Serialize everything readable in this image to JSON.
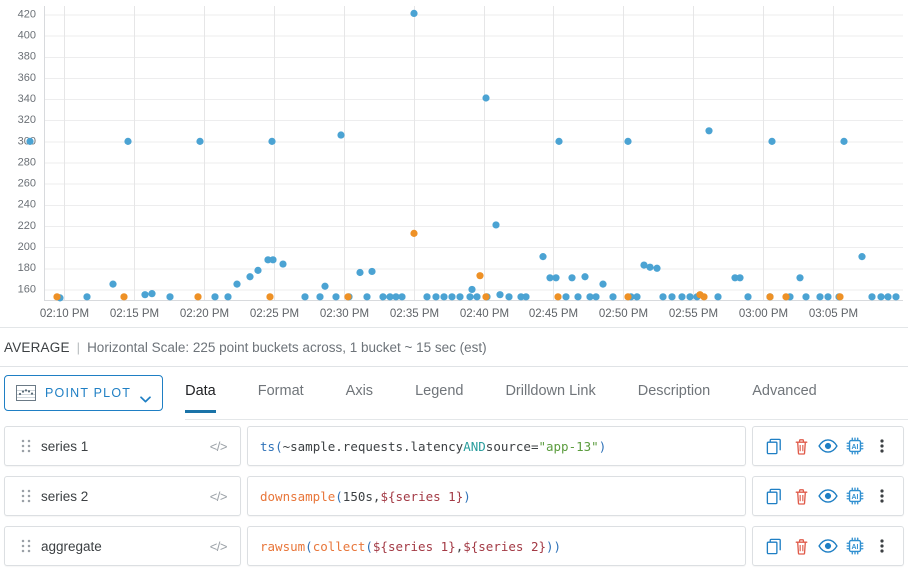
{
  "chart_data": {
    "type": "scatter",
    "title": "",
    "xlabel": "",
    "ylabel": "",
    "ylim": [
      150,
      428
    ],
    "yticks": [
      160,
      180,
      200,
      220,
      240,
      260,
      280,
      300,
      320,
      340,
      360,
      380,
      400,
      420
    ],
    "xticks": [
      "02:10 PM",
      "02:15 PM",
      "02:20 PM",
      "02:25 PM",
      "02:30 PM",
      "02:35 PM",
      "02:40 PM",
      "02:45 PM",
      "02:50 PM",
      "02:55 PM",
      "03:00 PM",
      "03:05 PM"
    ],
    "grid": true,
    "legend": "none",
    "series": [
      {
        "name": "series 1",
        "color": "#4ba3d3",
        "points": [
          [
            30,
            300
          ],
          [
            60,
            152
          ],
          [
            87,
            153
          ],
          [
            113,
            165
          ],
          [
            128,
            300
          ],
          [
            145,
            155
          ],
          [
            152,
            156
          ],
          [
            170,
            153
          ],
          [
            200,
            300
          ],
          [
            215,
            153
          ],
          [
            228,
            153
          ],
          [
            237,
            165
          ],
          [
            250,
            172
          ],
          [
            258,
            178
          ],
          [
            268,
            188
          ],
          [
            273,
            188
          ],
          [
            283,
            184
          ],
          [
            272,
            300
          ],
          [
            305,
            153
          ],
          [
            320,
            153
          ],
          [
            325,
            163
          ],
          [
            336,
            153
          ],
          [
            341,
            306
          ],
          [
            349,
            153
          ],
          [
            360,
            176
          ],
          [
            367,
            153
          ],
          [
            372,
            177
          ],
          [
            383,
            153
          ],
          [
            390,
            153
          ],
          [
            396,
            153
          ],
          [
            402,
            153
          ],
          [
            414,
            421
          ],
          [
            427,
            153
          ],
          [
            436,
            153
          ],
          [
            444,
            153
          ],
          [
            452,
            153
          ],
          [
            460,
            153
          ],
          [
            470,
            153
          ],
          [
            472,
            160
          ],
          [
            477,
            153
          ],
          [
            486,
            341
          ],
          [
            487,
            153
          ],
          [
            496,
            221
          ],
          [
            500,
            155
          ],
          [
            509,
            153
          ],
          [
            521,
            153
          ],
          [
            526,
            153
          ],
          [
            543,
            191
          ],
          [
            550,
            171
          ],
          [
            556,
            171
          ],
          [
            559,
            300
          ],
          [
            566,
            153
          ],
          [
            572,
            171
          ],
          [
            578,
            153
          ],
          [
            585,
            172
          ],
          [
            590,
            153
          ],
          [
            596,
            153
          ],
          [
            603,
            165
          ],
          [
            613,
            153
          ],
          [
            628,
            300
          ],
          [
            631,
            153
          ],
          [
            637,
            153
          ],
          [
            644,
            183
          ],
          [
            650,
            181
          ],
          [
            657,
            180
          ],
          [
            663,
            153
          ],
          [
            672,
            153
          ],
          [
            682,
            153
          ],
          [
            690,
            153
          ],
          [
            697,
            153
          ],
          [
            709,
            310
          ],
          [
            718,
            153
          ],
          [
            735,
            171
          ],
          [
            740,
            171
          ],
          [
            748,
            153
          ],
          [
            770,
            153
          ],
          [
            772,
            300
          ],
          [
            790,
            153
          ],
          [
            800,
            171
          ],
          [
            806,
            153
          ],
          [
            820,
            153
          ],
          [
            828,
            153
          ],
          [
            839,
            153
          ],
          [
            844,
            300
          ],
          [
            862,
            191
          ],
          [
            872,
            153
          ],
          [
            881,
            153
          ],
          [
            888,
            153
          ],
          [
            896,
            153
          ]
        ]
      },
      {
        "name": "series 2",
        "color": "#ee9126",
        "points": [
          [
            57,
            153
          ],
          [
            124,
            153
          ],
          [
            198,
            153
          ],
          [
            270,
            153
          ],
          [
            348,
            153
          ],
          [
            414,
            213
          ],
          [
            480,
            173
          ],
          [
            486,
            153
          ],
          [
            558,
            153
          ],
          [
            628,
            153
          ],
          [
            700,
            155
          ],
          [
            704,
            153
          ],
          [
            770,
            153
          ],
          [
            786,
            153
          ],
          [
            840,
            153
          ]
        ]
      }
    ]
  },
  "status": {
    "aggregation": "AVERAGE",
    "separator": "|",
    "scale_text": "Horizontal Scale: 225 point buckets across, 1 bucket ~ 15 sec (est)"
  },
  "toolbar": {
    "plot_type_label": "POINT PLOT",
    "plot_type_icon": "point-plot-thumbnail-icon",
    "chevron_icon": "chevron-down-icon"
  },
  "tabs": [
    {
      "label": "Data",
      "active": true
    },
    {
      "label": "Format",
      "active": false
    },
    {
      "label": "Axis",
      "active": false
    },
    {
      "label": "Legend",
      "active": false
    },
    {
      "label": "Drilldown Link",
      "active": false
    },
    {
      "label": "Description",
      "active": false
    },
    {
      "label": "Advanced",
      "active": false
    }
  ],
  "rows": [
    {
      "name": "series 1",
      "code_icon": "</>",
      "expression": "ts(~sample.requests.latency AND source=\"app-13\")",
      "tokens": [
        {
          "t": "ts",
          "c": "tk-fn-blue"
        },
        {
          "t": "(",
          "c": "tk-paren-b"
        },
        {
          "t": "~sample.requests.latency ",
          "c": "tk-plain"
        },
        {
          "t": "AND",
          "c": "tk-kw"
        },
        {
          "t": " source=",
          "c": "tk-plain"
        },
        {
          "t": "\"app-13\"",
          "c": "tk-str"
        },
        {
          "t": ")",
          "c": "tk-paren-b"
        }
      ]
    },
    {
      "name": "series 2",
      "code_icon": "</>",
      "expression": "downsample(150s, ${series 1})",
      "tokens": [
        {
          "t": "downsample",
          "c": "tk-fn-orange"
        },
        {
          "t": "(",
          "c": "tk-paren-b"
        },
        {
          "t": "150s, ",
          "c": "tk-num"
        },
        {
          "t": "${series 1}",
          "c": "tk-var"
        },
        {
          "t": ")",
          "c": "tk-paren-b"
        }
      ]
    },
    {
      "name": "aggregate",
      "code_icon": "</>",
      "expression": "rawsum(collect(${series 1}, ${series 2}))",
      "tokens": [
        {
          "t": "rawsum",
          "c": "tk-fn-orange"
        },
        {
          "t": "(",
          "c": "tk-paren-b"
        },
        {
          "t": "collect",
          "c": "tk-fn-orange"
        },
        {
          "t": "(",
          "c": "tk-paren-b"
        },
        {
          "t": "${series 1}",
          "c": "tk-var"
        },
        {
          "t": ", ",
          "c": "tk-plain"
        },
        {
          "t": "${series 2}",
          "c": "tk-var"
        },
        {
          "t": "))",
          "c": "tk-paren-b"
        }
      ]
    }
  ],
  "row_actions": [
    {
      "name": "clone-icon",
      "title": "Clone"
    },
    {
      "name": "delete-icon",
      "title": "Delete"
    },
    {
      "name": "visibility-icon",
      "title": "Show / Hide"
    },
    {
      "name": "ai-chip-icon",
      "title": "AI"
    },
    {
      "name": "more-options-icon",
      "title": "More"
    }
  ],
  "colors": {
    "series1": "#4ba3d3",
    "series2": "#ee9126",
    "accent": "#1f7fc4",
    "tab_active_underline": "#1a73a8",
    "delete_red": "#e05b4a",
    "action_blue": "#1f7fc4"
  }
}
